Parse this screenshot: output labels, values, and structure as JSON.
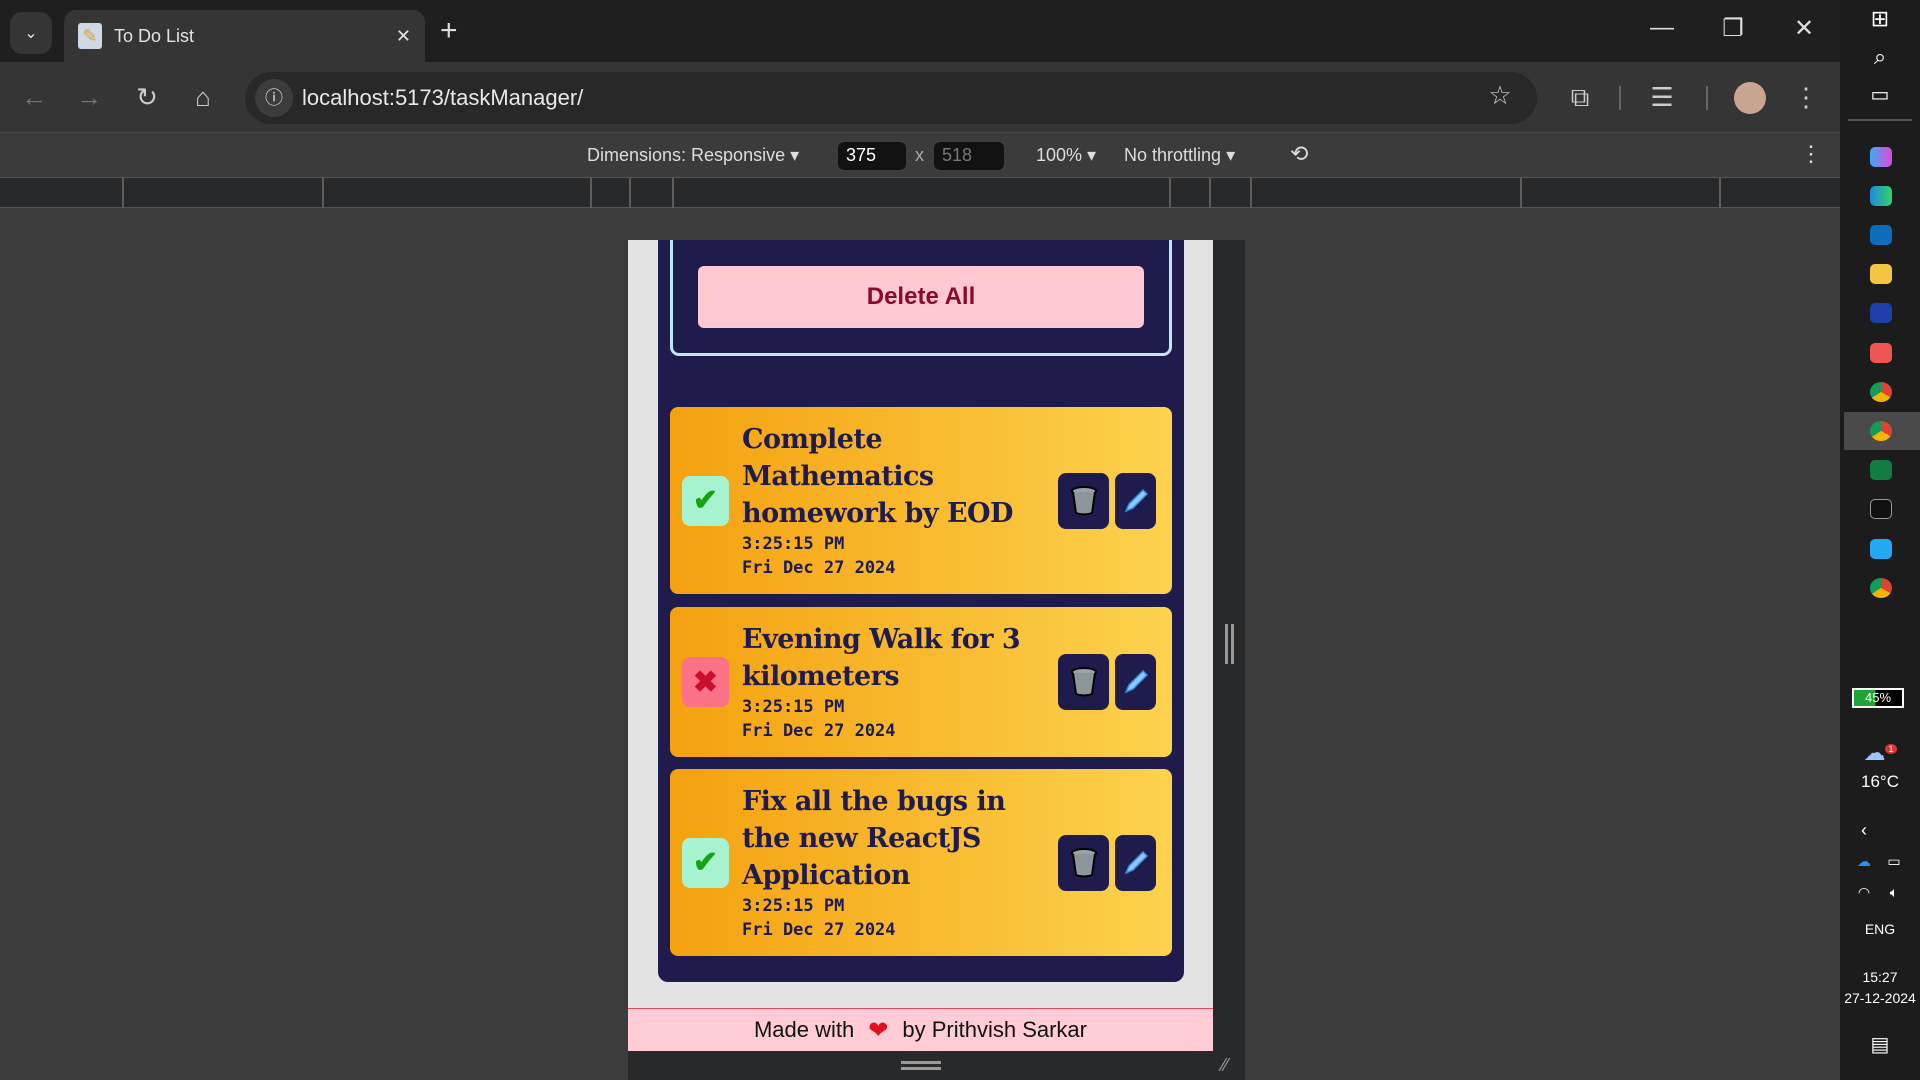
{
  "browser": {
    "tab_title": "To Do List",
    "url": "localhost:5173/taskManager/"
  },
  "devtools": {
    "dimensions": "Dimensions: Responsive",
    "width": "375",
    "times": "x",
    "height": "518",
    "zoom": "100%",
    "throttling": "No throttling"
  },
  "app": {
    "delete_all": "Delete All",
    "tasks": [
      {
        "title": "Complete Mathematics homework by EOD",
        "time": "3:25:15 PM",
        "date": "Fri Dec 27 2024",
        "completed": true
      },
      {
        "title": "Evening Walk for 3 kilometers",
        "time": "3:25:15 PM",
        "date": "Fri Dec 27 2024",
        "completed": false
      },
      {
        "title": "Fix all the bugs in the new ReactJS Application",
        "time": "3:25:15 PM",
        "date": "Fri Dec 27 2024",
        "completed": true
      }
    ],
    "footer": {
      "prefix": "Made with",
      "suffix": "by Prithvish Sarkar"
    }
  },
  "taskbar": {
    "battery": "45%",
    "temperature": "16°C",
    "language": "ENG",
    "time": "15:27",
    "date": "27-12-2024",
    "weather_badge": "1"
  },
  "colors": {
    "navy": "#1f1b4d",
    "card_start": "#f4a10f",
    "card_end": "#fcd24e",
    "pink": "#ffccd5"
  }
}
